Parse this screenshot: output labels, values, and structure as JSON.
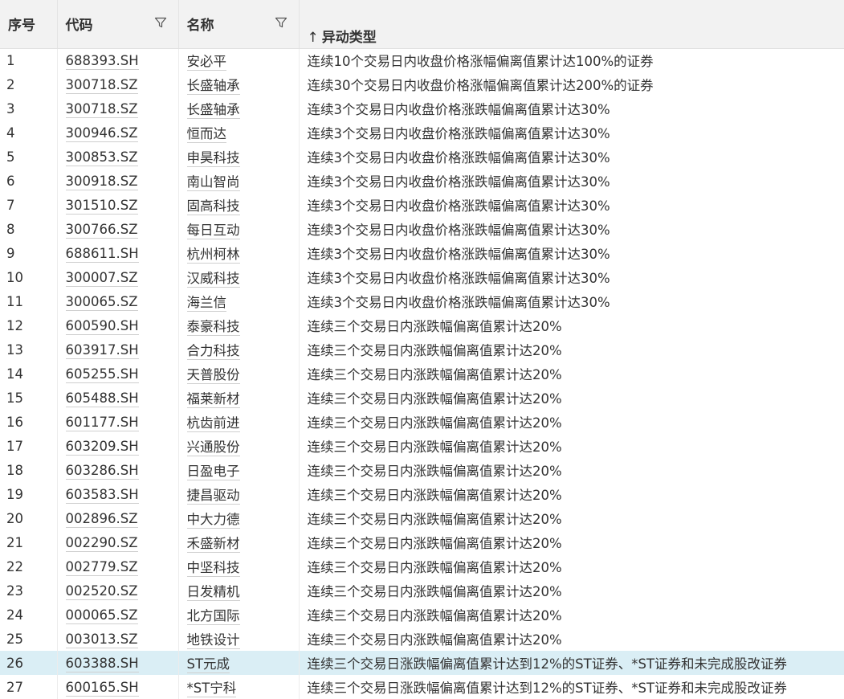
{
  "header": {
    "index": "序号",
    "code": "代码",
    "name": "名称",
    "type": "异动类型",
    "sort_icon": "↑"
  },
  "rows": [
    {
      "index": "1",
      "code": "688393.SH",
      "name": "安必平",
      "type": "连续10个交易日内收盘价格涨幅偏离值累计达100%的证券"
    },
    {
      "index": "2",
      "code": "300718.SZ",
      "name": "长盛轴承",
      "type": "连续30个交易日内收盘价格涨幅偏离值累计达200%的证券"
    },
    {
      "index": "3",
      "code": "300718.SZ",
      "name": "长盛轴承",
      "type": "连续3个交易日内收盘价格涨跌幅偏离值累计达30%"
    },
    {
      "index": "4",
      "code": "300946.SZ",
      "name": "恒而达",
      "type": "连续3个交易日内收盘价格涨跌幅偏离值累计达30%"
    },
    {
      "index": "5",
      "code": "300853.SZ",
      "name": "申昊科技",
      "type": "连续3个交易日内收盘价格涨跌幅偏离值累计达30%"
    },
    {
      "index": "6",
      "code": "300918.SZ",
      "name": "南山智尚",
      "type": "连续3个交易日内收盘价格涨跌幅偏离值累计达30%"
    },
    {
      "index": "7",
      "code": "301510.SZ",
      "name": "固高科技",
      "type": "连续3个交易日内收盘价格涨跌幅偏离值累计达30%"
    },
    {
      "index": "8",
      "code": "300766.SZ",
      "name": "每日互动",
      "type": "连续3个交易日内收盘价格涨跌幅偏离值累计达30%"
    },
    {
      "index": "9",
      "code": "688611.SH",
      "name": "杭州柯林",
      "type": "连续3个交易日内收盘价格涨跌幅偏离值累计达30%"
    },
    {
      "index": "10",
      "code": "300007.SZ",
      "name": "汉威科技",
      "type": "连续3个交易日内收盘价格涨跌幅偏离值累计达30%"
    },
    {
      "index": "11",
      "code": "300065.SZ",
      "name": "海兰信",
      "type": "连续3个交易日内收盘价格涨跌幅偏离值累计达30%"
    },
    {
      "index": "12",
      "code": "600590.SH",
      "name": "泰豪科技",
      "type": "连续三个交易日内涨跌幅偏离值累计达20%"
    },
    {
      "index": "13",
      "code": "603917.SH",
      "name": "合力科技",
      "type": "连续三个交易日内涨跌幅偏离值累计达20%"
    },
    {
      "index": "14",
      "code": "605255.SH",
      "name": "天普股份",
      "type": "连续三个交易日内涨跌幅偏离值累计达20%"
    },
    {
      "index": "15",
      "code": "605488.SH",
      "name": "福莱新材",
      "type": "连续三个交易日内涨跌幅偏离值累计达20%"
    },
    {
      "index": "16",
      "code": "601177.SH",
      "name": "杭齿前进",
      "type": "连续三个交易日内涨跌幅偏离值累计达20%"
    },
    {
      "index": "17",
      "code": "603209.SH",
      "name": "兴通股份",
      "type": "连续三个交易日内涨跌幅偏离值累计达20%"
    },
    {
      "index": "18",
      "code": "603286.SH",
      "name": "日盈电子",
      "type": "连续三个交易日内涨跌幅偏离值累计达20%"
    },
    {
      "index": "19",
      "code": "603583.SH",
      "name": "捷昌驱动",
      "type": "连续三个交易日内涨跌幅偏离值累计达20%"
    },
    {
      "index": "20",
      "code": "002896.SZ",
      "name": "中大力德",
      "type": "连续三个交易日内涨跌幅偏离值累计达20%"
    },
    {
      "index": "21",
      "code": "002290.SZ",
      "name": "禾盛新材",
      "type": "连续三个交易日内涨跌幅偏离值累计达20%"
    },
    {
      "index": "22",
      "code": "002779.SZ",
      "name": "中坚科技",
      "type": "连续三个交易日内涨跌幅偏离值累计达20%"
    },
    {
      "index": "23",
      "code": "002520.SZ",
      "name": "日发精机",
      "type": "连续三个交易日内涨跌幅偏离值累计达20%"
    },
    {
      "index": "24",
      "code": "000065.SZ",
      "name": "北方国际",
      "type": "连续三个交易日内涨跌幅偏离值累计达20%"
    },
    {
      "index": "25",
      "code": "003013.SZ",
      "name": "地铁设计",
      "type": "连续三个交易日内涨跌幅偏离值累计达20%"
    },
    {
      "index": "26",
      "code": "603388.SH",
      "name": "ST元成",
      "type": "连续三个交易日涨跌幅偏离值累计达到12%的ST证券、*ST证券和未完成股改证券"
    },
    {
      "index": "27",
      "code": "600165.SH",
      "name": "*ST宁科",
      "type": "连续三个交易日涨跌幅偏离值累计达到12%的ST证券、*ST证券和未完成股改证券"
    }
  ],
  "selected_row_index": 26,
  "colors": {
    "header_bg": "#f2f2f2",
    "selected_bg": "#daeef5",
    "text": "#333333"
  }
}
